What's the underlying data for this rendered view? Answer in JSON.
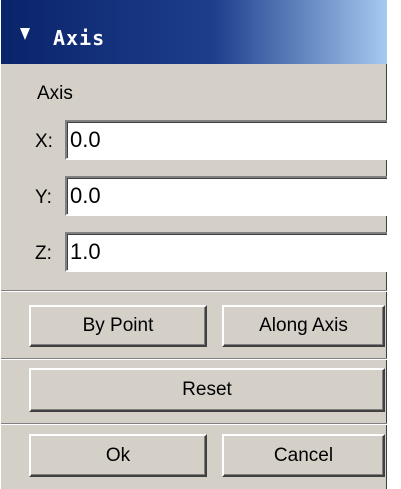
{
  "titlebar": {
    "title": "Axis",
    "collapse_icon": "triangle-down-icon"
  },
  "axis_section": {
    "label": "Axis"
  },
  "fields": {
    "x": {
      "label": "X:",
      "value": "0.0"
    },
    "y": {
      "label": "Y:",
      "value": "0.0"
    },
    "z": {
      "label": "Z:",
      "value": "1.0"
    }
  },
  "buttons": {
    "by_point": "By Point",
    "along_axis": "Along Axis",
    "reset": "Reset",
    "ok": "Ok",
    "cancel": "Cancel"
  },
  "colors": {
    "title_bar_start": "#0a246a",
    "title_bar_end": "#a6caf0",
    "panel": "#d4d0c8"
  }
}
